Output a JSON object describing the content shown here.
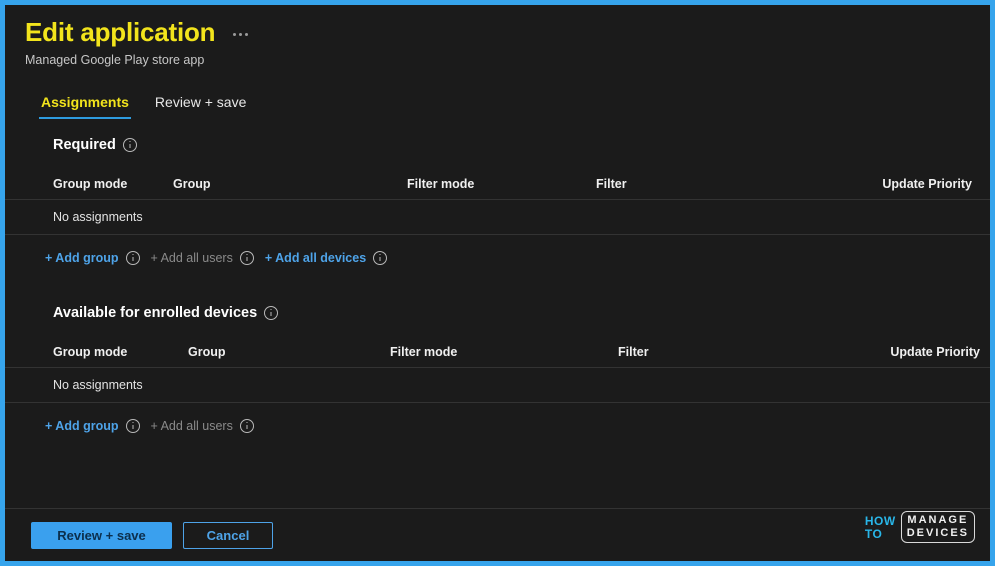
{
  "header": {
    "title": "Edit application",
    "subtitle": "Managed Google Play store app",
    "more_menu_label": "More commands"
  },
  "tabs": [
    {
      "label": "Assignments",
      "active": true
    },
    {
      "label": "Review + save",
      "active": false
    }
  ],
  "sections": [
    {
      "heading": "Required",
      "columns": {
        "group_mode": "Group mode",
        "group": "Group",
        "filter_mode": "Filter mode",
        "filter": "Filter",
        "update_priority": "Update Priority"
      },
      "empty_text": "No assignments",
      "links": [
        {
          "label": "+ Add group",
          "disabled": false
        },
        {
          "label": "+ Add all users",
          "disabled": true
        },
        {
          "label": "+ Add all devices",
          "disabled": false
        }
      ]
    },
    {
      "heading": "Available for enrolled devices",
      "columns": {
        "group_mode": "Group mode",
        "group": "Group",
        "filter_mode": "Filter mode",
        "filter": "Filter",
        "update_priority": "Update Priority"
      },
      "empty_text": "No assignments",
      "links": [
        {
          "label": "+ Add group",
          "disabled": false
        },
        {
          "label": "+ Add all users",
          "disabled": true
        }
      ]
    }
  ],
  "footer": {
    "primary_label": "Review + save",
    "secondary_label": "Cancel"
  },
  "watermark": {
    "how": "HOW",
    "to": "TO",
    "manage": "MANAGE",
    "devices": "DEVICES"
  },
  "colors": {
    "frame_blue": "#36a4ec",
    "accent_yellow": "#f2e41c",
    "link_blue": "#4ea3e8",
    "tab_underline": "#2e9bdf",
    "background": "#1b1b1b",
    "separator": "#333333",
    "disabled_text": "#8a8a8a"
  }
}
